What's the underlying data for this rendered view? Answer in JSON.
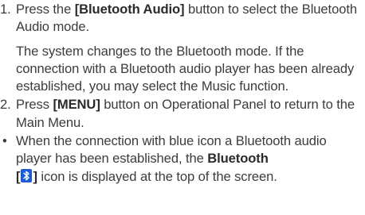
{
  "steps": [
    {
      "number": "1.",
      "pre": "Press the ",
      "bold": "[Bluetooth Audio]",
      "post": " button to select the Bluetooth Audio mode."
    },
    {
      "note": "The system changes to the Bluetooth mode. If the connection with a Bluetooth audio player has been already established, you may select the Music function."
    },
    {
      "number": "2.",
      "pre": "Press ",
      "bold": "[MENU]",
      "post": " button on Operational Panel to return to the Main Menu."
    }
  ],
  "bullet": {
    "marker": "•",
    "pre": "When the connection with blue icon a Bluetooth audio player has been established, the ",
    "bold": "Bluetooth",
    "bracket_open": "[",
    "bracket_close": "]",
    "post": " icon is displayed at the top of the screen.",
    "icon": "bluetooth-icon",
    "icon_color": "#1d5bd6"
  },
  "colors": {
    "text": "#3c3c3c",
    "bluetooth_blue": "#1d5bd6"
  }
}
